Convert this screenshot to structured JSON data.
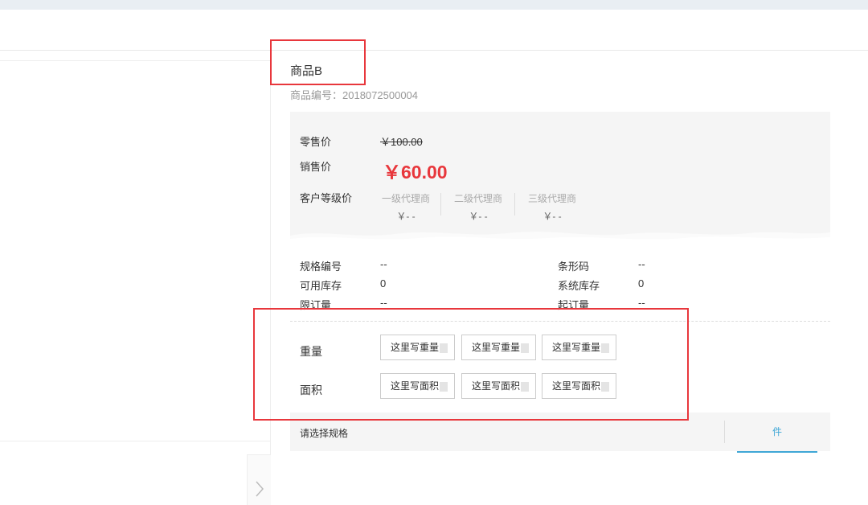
{
  "product": {
    "name": "商品B",
    "code_label": "商品编号：",
    "code_value": "2018072500004"
  },
  "price": {
    "retail_label": "零售价",
    "retail_value": "￥100.00",
    "sale_label": "销售价",
    "sale_value": "￥60.00",
    "tier_label": "客户等级价",
    "tiers": [
      {
        "name": "一级代理商",
        "price": "￥- -"
      },
      {
        "name": "二级代理商",
        "price": "￥- -"
      },
      {
        "name": "三级代理商",
        "price": "￥- -"
      }
    ]
  },
  "specs": {
    "spec_code_label": "规格编号",
    "spec_code_value": "--",
    "barcode_label": "条形码",
    "barcode_value": "--",
    "avail_stock_label": "可用库存",
    "avail_stock_value": "0",
    "sys_stock_label": "系统库存",
    "sys_stock_value": "0",
    "limit_label": "限订量",
    "limit_value": "--",
    "min_label": "起订量",
    "min_value": "--"
  },
  "options": {
    "weight_label": "重量",
    "weight_buttons": [
      "这里写重量",
      "这里写重量",
      "这里写重量"
    ],
    "area_label": "面积",
    "area_buttons": [
      "这里写面积",
      "这里写面积",
      "这里写面积"
    ]
  },
  "bottom": {
    "select_prompt": "请选择规格",
    "unit_label": "件"
  },
  "colors": {
    "accent_red": "#e8373c",
    "accent_blue": "#3fa7d6",
    "price_box_bg": "#f5f5f5"
  },
  "icons": {
    "next": "chevron-right-icon"
  }
}
